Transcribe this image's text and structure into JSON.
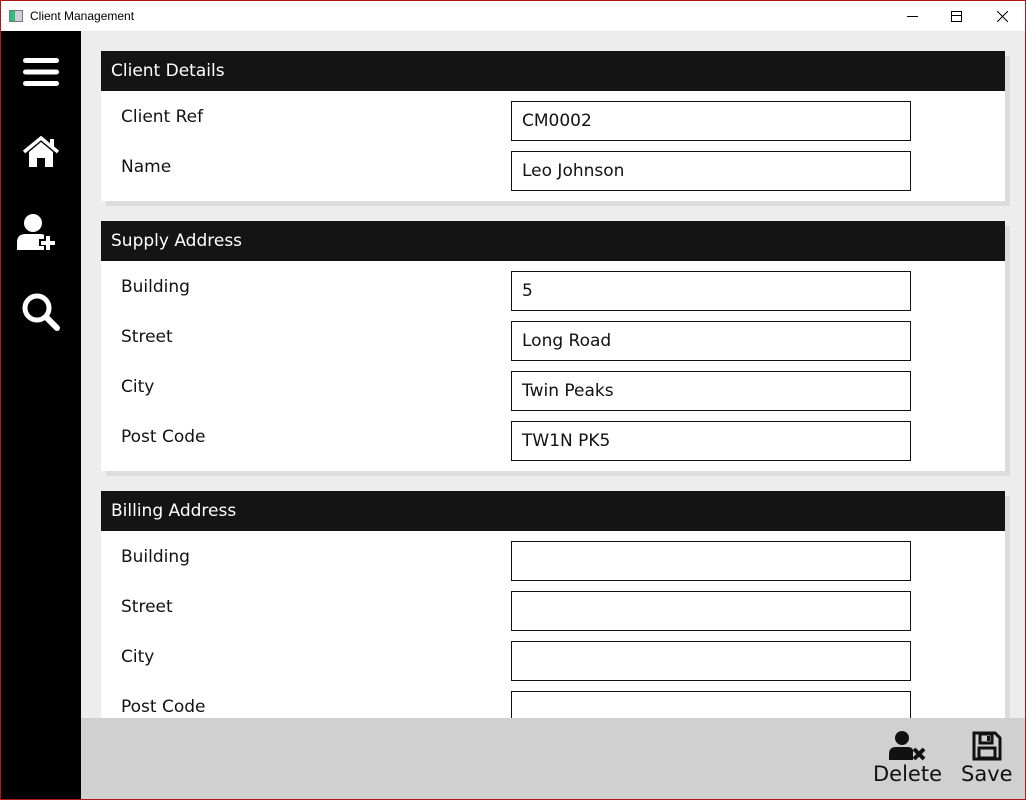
{
  "window": {
    "title": "Client Management",
    "minimize": "—",
    "maximize": "☐",
    "close": "✕"
  },
  "sidebar": {
    "items": [
      {
        "name": "menu"
      },
      {
        "name": "home"
      },
      {
        "name": "add-client"
      },
      {
        "name": "search"
      }
    ]
  },
  "sections": [
    {
      "title": "Client Details",
      "fields": [
        {
          "label": "Client Ref",
          "value": "CM0002"
        },
        {
          "label": "Name",
          "value": "Leo Johnson"
        }
      ]
    },
    {
      "title": "Supply Address",
      "fields": [
        {
          "label": "Building",
          "value": "5"
        },
        {
          "label": "Street",
          "value": "Long Road"
        },
        {
          "label": "City",
          "value": "Twin Peaks"
        },
        {
          "label": "Post Code",
          "value": "TW1N PK5"
        }
      ]
    },
    {
      "title": "Billing Address",
      "fields": [
        {
          "label": "Building",
          "value": ""
        },
        {
          "label": "Street",
          "value": ""
        },
        {
          "label": "City",
          "value": ""
        },
        {
          "label": "Post Code",
          "value": ""
        }
      ]
    }
  ],
  "footer": {
    "delete_label": "Delete",
    "save_label": "Save"
  }
}
